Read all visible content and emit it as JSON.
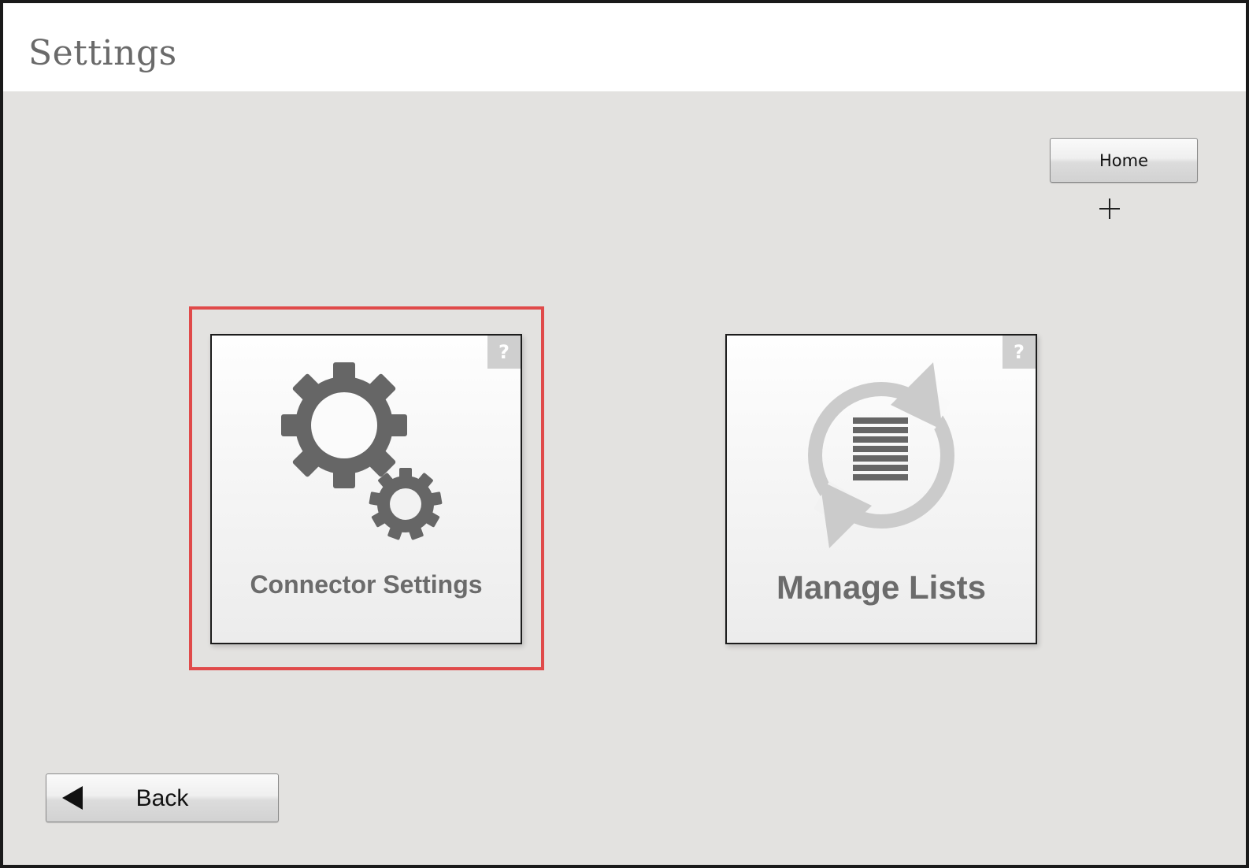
{
  "header": {
    "title": "Settings"
  },
  "toolbar": {
    "home_label": "Home"
  },
  "tiles": [
    {
      "label": "Connector Settings",
      "help": "?",
      "icon": "gears-icon",
      "highlighted": true
    },
    {
      "label": "Manage Lists",
      "help": "?",
      "icon": "list-sync-icon",
      "highlighted": false
    }
  ],
  "footer": {
    "back_label": "Back"
  },
  "colors": {
    "background": "#e3e2e0",
    "highlight": "#e04a4a",
    "icon_dark": "#666666",
    "icon_light": "#cbcbcb"
  }
}
